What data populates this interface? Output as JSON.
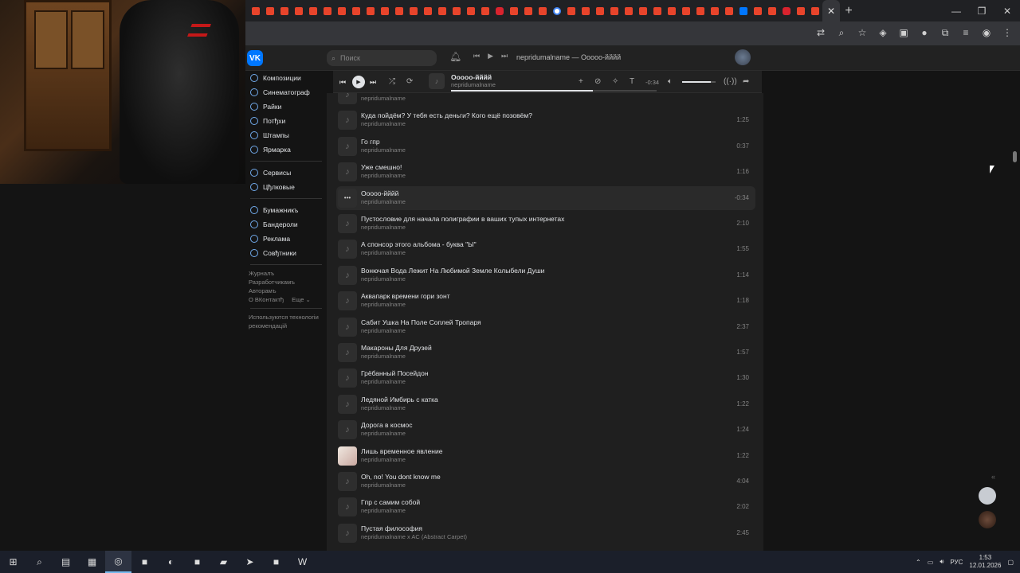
{
  "browser": {
    "tab_icons": [
      "mail",
      "mail",
      "mail",
      "mail",
      "mail",
      "mail",
      "mail",
      "mail",
      "mail",
      "mail",
      "mail",
      "mail",
      "mail",
      "mail",
      "mail",
      "mail",
      "mail",
      "mail",
      "mail",
      "mail",
      "mail",
      "mail",
      "mail",
      "mail",
      "mail",
      "mail",
      "mail",
      "mail",
      "mail",
      "mail",
      "mail",
      "mail",
      "mail",
      "mail",
      "mail",
      "mail",
      "mail",
      "mail",
      "mail",
      "mail"
    ],
    "active_tab_close": "✕",
    "new_tab": "+",
    "window_controls": [
      "—",
      "❐",
      "✕"
    ]
  },
  "vk": {
    "logo": "VK",
    "search_placeholder": "Поиск",
    "header_track": "nepridumalname — Ооооо-йййй"
  },
  "nav": {
    "main": [
      "Композиции",
      "Синематограф",
      "Райки",
      "Потђхи",
      "Штампы",
      "Ярмарка"
    ],
    "services": [
      "Сервисы",
      "Цђлковые"
    ],
    "business": [
      "Бумажникъ",
      "Бандероли",
      "Реклама",
      "Совђтники"
    ],
    "footer_links": [
      "Журналъ",
      "Разработчикамъ",
      "Авторамъ"
    ],
    "about": "О ВКонтактђ",
    "more": "Еще ⌄",
    "tech_note": "Используются технологіи рекомендацій"
  },
  "player": {
    "title": "Ооооо-йййй",
    "artist": "nepridumalname",
    "time": "-0:34",
    "progress": 0.69,
    "volume": 0.85
  },
  "tracks": [
    {
      "title": "",
      "artist": "nepridumalname",
      "duration": "",
      "cover": "note"
    },
    {
      "title": "Куда пойдём? У тебя есть деньги? Кого ещё позовём?",
      "artist": "nepridumalname",
      "duration": "1:25",
      "cover": "note"
    },
    {
      "title": "Го гпр",
      "artist": "nepridumalname",
      "duration": "0:37",
      "cover": "note"
    },
    {
      "title": "Уже смешно!",
      "artist": "nepridumalname",
      "duration": "1:16",
      "cover": "note"
    },
    {
      "title": "Ооооо-йййй",
      "artist": "nepridumalname",
      "duration": "-0:34",
      "cover": "dots",
      "active": true
    },
    {
      "title": "Пустословие для начала полиграфии в ваших тупых интернетах",
      "artist": "nepridumalname",
      "duration": "2:10",
      "cover": "note"
    },
    {
      "title": "А спонсор этого альбома - буква \"Ы\"",
      "artist": "nepridumalname",
      "duration": "1:55",
      "cover": "note"
    },
    {
      "title": "Вонючая Вода Лежит На Любимой Земле Колыбели Души",
      "artist": "nepridumalname",
      "duration": "1:14",
      "cover": "note"
    },
    {
      "title": "Аквапарк времени гори зонт",
      "artist": "nepridumalname",
      "duration": "1:18",
      "cover": "note"
    },
    {
      "title": "Сабит Ушка На Поле Соплей Тропаря",
      "artist": "nepridumalname",
      "duration": "2:37",
      "cover": "note"
    },
    {
      "title": "Макароны Для Друзей",
      "artist": "nepridumalname",
      "duration": "1:57",
      "cover": "note"
    },
    {
      "title": "Грёбанный Посейдон",
      "artist": "nepridumalname",
      "duration": "1:30",
      "cover": "note"
    },
    {
      "title": "Ледяной Имбирь с катка",
      "artist": "nepridumalname",
      "duration": "1:22",
      "cover": "note"
    },
    {
      "title": "Дорога в космос",
      "artist": "nepridumalname",
      "duration": "1:24",
      "cover": "note"
    },
    {
      "title": "Лишь временное явление",
      "artist": "nepridumalname",
      "duration": "1:22",
      "cover": "photo"
    },
    {
      "title": "Oh, no! You dont know me",
      "artist": "nepridumalname",
      "duration": "4:04",
      "cover": "note"
    },
    {
      "title": "Гпр с самим собой",
      "artist": "nepridumalname",
      "duration": "2:02",
      "cover": "note"
    },
    {
      "title": "Пустая философия",
      "artist": "nepridumalname x AC (Abstract Carpet)",
      "duration": "2:45",
      "cover": "note"
    }
  ],
  "taskbar": {
    "apps": [
      "start-icon",
      "search-icon",
      "file-icon",
      "calculator-icon",
      "chrome-icon",
      "app-icon",
      "steam-icon",
      "app-icon",
      "folder-icon",
      "telegram-icon",
      "app-icon",
      "word-icon"
    ],
    "tray_lang": "РУС",
    "time": "1:53",
    "date": "12.01.2026"
  }
}
